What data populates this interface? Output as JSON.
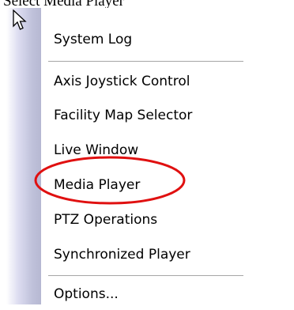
{
  "caption": "Select Media Player",
  "menu": {
    "items": [
      {
        "label": "System Log"
      },
      {
        "label": "Axis Joystick Control"
      },
      {
        "label": "Facility Map Selector"
      },
      {
        "label": "Live Window"
      },
      {
        "label": "Media Player"
      },
      {
        "label": "PTZ Operations"
      },
      {
        "label": "Synchronized Player"
      },
      {
        "label": "Options..."
      }
    ]
  },
  "highlight": {
    "target": "Media Player",
    "color": "#e01010"
  },
  "icons": {
    "pointer": "arrow-cursor-icon"
  }
}
